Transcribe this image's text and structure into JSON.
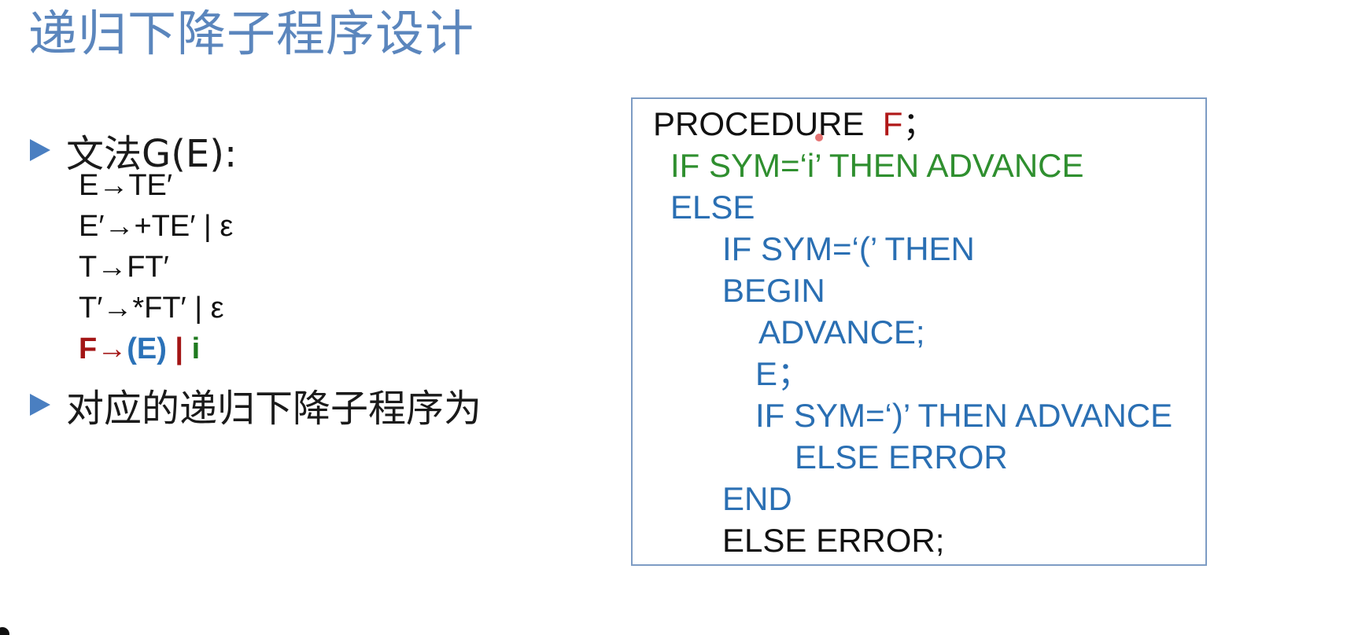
{
  "slide": {
    "title": "递归下降子程序设计",
    "bullets": [
      {
        "text": "文法G(E):"
      },
      {
        "text": "对应的递归下降子程序为"
      }
    ],
    "grammar": {
      "rules": [
        "E→TE′",
        "E′→+TE′ | ε",
        "T→FT′",
        "T′→*FT′ | ε"
      ],
      "highlight_rule": {
        "lhs": "F→",
        "paren": "(E)",
        "bar": " | ",
        "terminal": "i"
      }
    },
    "code": {
      "line1_keyword": "PROCEDURE",
      "line1_name": "F",
      "line1_end": "；",
      "lines": [
        "IF SYM=‘i’ THEN ADVANCE",
        "ELSE",
        "IF SYM=‘(’ THEN",
        "BEGIN",
        "ADVANCE;",
        "E；",
        "IF SYM=‘)’ THEN ADVANCE",
        "ELSE ERROR",
        "END",
        "ELSE ERROR;"
      ]
    },
    "colors": {
      "title": "#5b86bd",
      "bullet_marker": "#4a7fc1",
      "nonterminal_red": "#a31515",
      "paren_blue": "#2b72b8",
      "terminal_green": "#1f7a1f",
      "code_border": "#7d9cc4"
    },
    "icons": {
      "bullet": "triangle-right-icon"
    }
  }
}
